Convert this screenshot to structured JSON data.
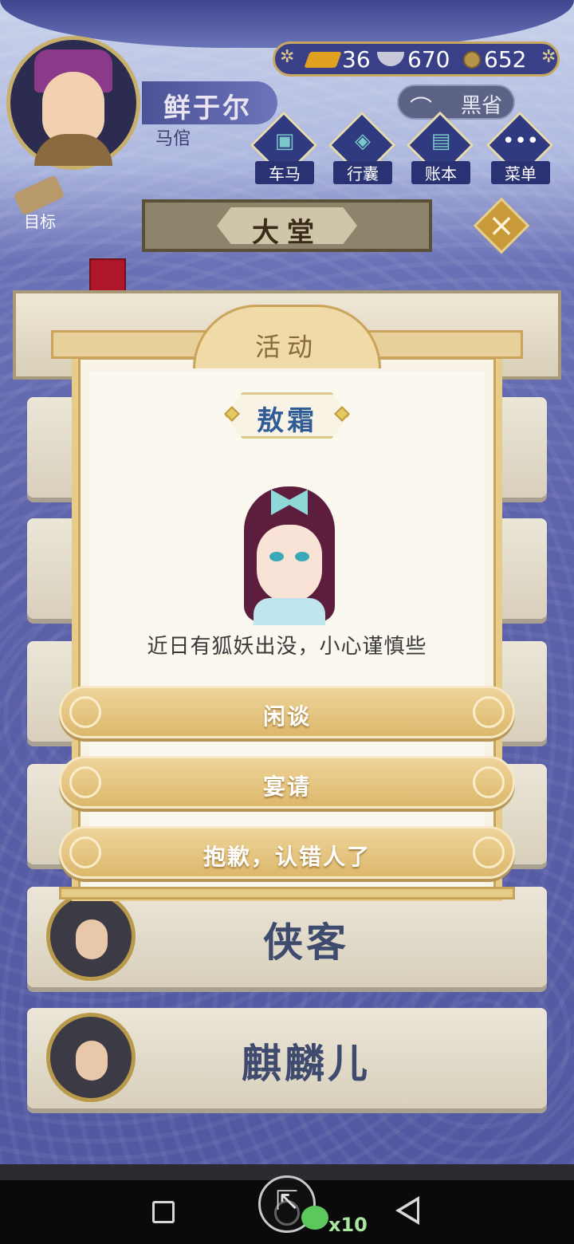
{
  "player": {
    "name": "鲜于尔",
    "title": "马倌"
  },
  "resources": {
    "gold_bars": "36",
    "silver": "670",
    "coins": "652"
  },
  "black_button": "黑省",
  "top_menu": [
    {
      "label": "车马",
      "icon": "carriage-icon"
    },
    {
      "label": "行囊",
      "icon": "bag-icon"
    },
    {
      "label": "账本",
      "icon": "ledger-icon"
    },
    {
      "label": "菜单",
      "icon": "more-icon"
    }
  ],
  "goal_button": "目标",
  "hall": {
    "title": "大堂"
  },
  "dialog": {
    "title": "活动",
    "npc_name": "敖霜",
    "npc_line": "近日有狐妖出没，小心谨慎些",
    "choices": [
      "闲谈",
      "宴请",
      "抱歉，认错人了"
    ]
  },
  "list": [
    {
      "name": "侠客"
    },
    {
      "name": "麒麟儿"
    }
  ],
  "bottom": {
    "multiplier": "x10"
  },
  "colors": {
    "accent_gold": "#e6cc88",
    "npc_name_blue": "#2f5b96",
    "background_purple": "#5a60a8"
  }
}
